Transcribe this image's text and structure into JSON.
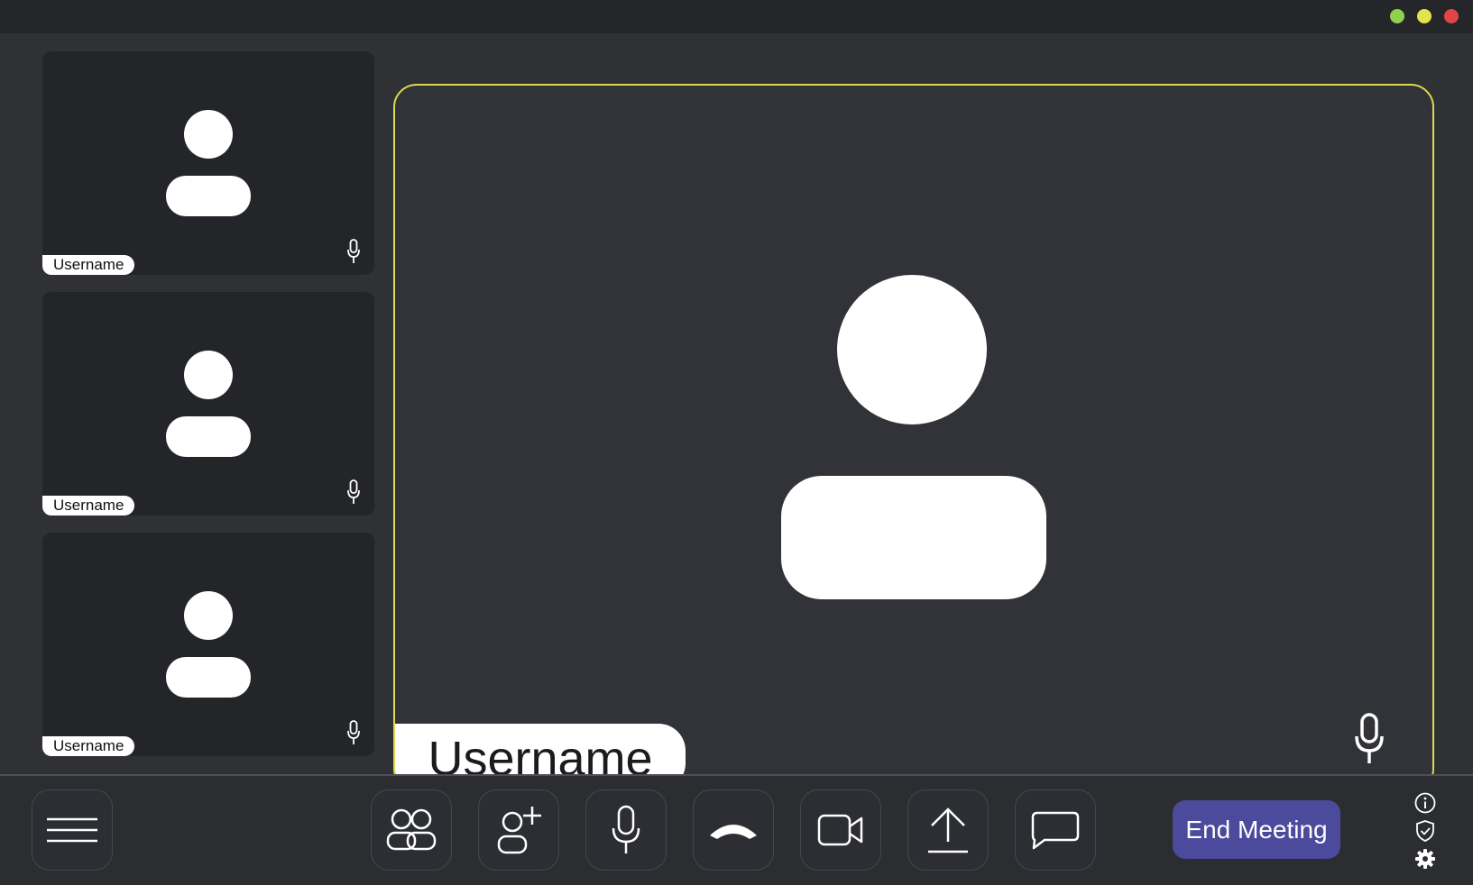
{
  "window": {
    "controls": [
      {
        "name": "maximize",
        "color": "#8fd14f"
      },
      {
        "name": "minimize",
        "color": "#e5e34a"
      },
      {
        "name": "close",
        "color": "#e04646"
      }
    ]
  },
  "participants": [
    {
      "name": "Username"
    },
    {
      "name": "Username"
    },
    {
      "name": "Username"
    }
  ],
  "active_speaker": {
    "name": "Username",
    "border_color": "#dcd94a"
  },
  "toolbar": {
    "menu_icon": "hamburger-icon",
    "buttons": [
      {
        "icon": "participants-icon"
      },
      {
        "icon": "add-user-icon"
      },
      {
        "icon": "microphone-icon"
      },
      {
        "icon": "hang-up-icon"
      },
      {
        "icon": "video-camera-icon"
      },
      {
        "icon": "share-upload-icon"
      },
      {
        "icon": "chat-icon"
      }
    ],
    "end_meeting_label": "End Meeting",
    "end_meeting_color": "#4b4a9c",
    "side_icons": [
      "info-icon",
      "shield-icon",
      "settings-gear-icon"
    ]
  }
}
